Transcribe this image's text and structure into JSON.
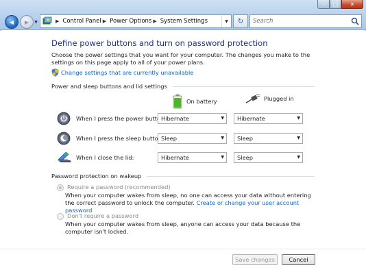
{
  "window": {
    "caption_min": "–",
    "caption_max": "▢",
    "caption_close": "✕"
  },
  "nav": {
    "back_glyph": "◀",
    "forward_glyph": "▶",
    "dropdown_glyph": "▼"
  },
  "address": {
    "breadcrumbs": [
      "Control Panel",
      "Power Options",
      "System Settings"
    ],
    "separator": "▶",
    "dropdown_glyph": "▼",
    "refresh_glyph": "↻"
  },
  "search": {
    "placeholder": "Search"
  },
  "page": {
    "title": "Define power buttons and turn on password protection",
    "intro": "Choose the power settings that you want for your computer. The changes you make to the settings on this page apply to all of your power plans.",
    "change_link": "Change settings that are currently unavailable"
  },
  "power_section": {
    "heading": "Power and sleep buttons and lid settings",
    "col_battery": "On battery",
    "col_plugged": "Plugged in",
    "rows": [
      {
        "label": "When I press the power button:",
        "battery": "Hibernate",
        "plugged": "Hibernate"
      },
      {
        "label": "When I press the sleep button:",
        "battery": "Sleep",
        "plugged": "Sleep"
      },
      {
        "label": "When I close the lid:",
        "battery": "Hibernate",
        "plugged": "Sleep"
      }
    ]
  },
  "password_section": {
    "heading": "Password protection on wakeup",
    "require": {
      "label": "Require a password (recommended)",
      "desc_before_link": "When your computer wakes from sleep, no one can access your data without entering the correct password to unlock the computer.",
      "link": "Create or change your user account password",
      "selected": true
    },
    "dont_require": {
      "label": "Don't require a password",
      "desc": "When your computer wakes from sleep, anyone can access your data because the computer isn't locked.",
      "selected": false
    }
  },
  "footer": {
    "save_label": "Save changes",
    "cancel_label": "Cancel"
  },
  "colors": {
    "title_blue": "#1e3287",
    "link_blue": "#0b63c1",
    "titlebar": "#bcd4ee"
  }
}
